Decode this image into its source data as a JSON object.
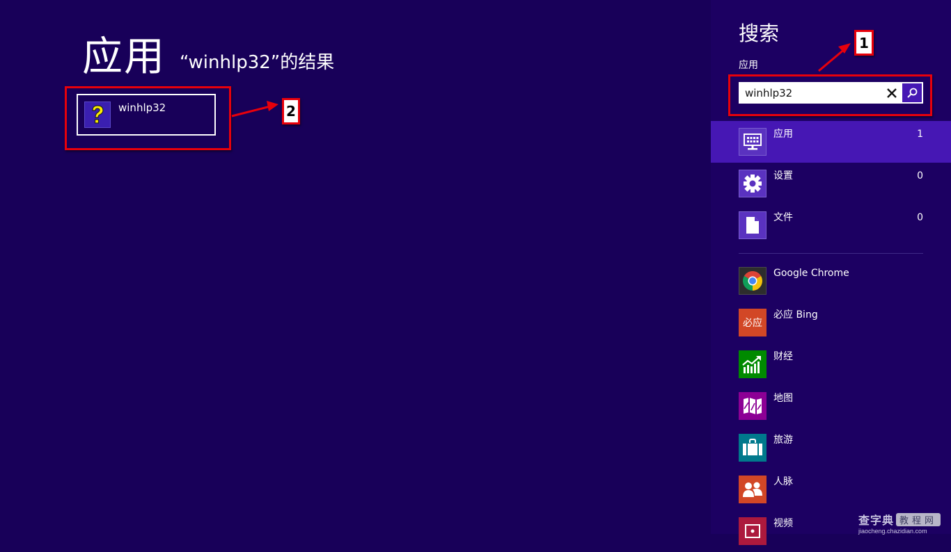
{
  "main": {
    "title": "应用",
    "subtitle": "“winhlp32”的结果",
    "results": [
      {
        "label": "winhlp32",
        "icon": "help-question-icon"
      }
    ]
  },
  "search_pane": {
    "title": "搜索",
    "scope": "应用",
    "query": "winhlp32",
    "clear_icon": "close-icon",
    "search_icon": "search-icon",
    "categories": [
      {
        "label": "应用",
        "count": "1",
        "icon": "apps-icon",
        "selected": true
      },
      {
        "label": "设置",
        "count": "0",
        "icon": "gear-icon",
        "selected": false
      },
      {
        "label": "文件",
        "count": "0",
        "icon": "file-icon",
        "selected": false
      }
    ],
    "apps": [
      {
        "label": "Google Chrome",
        "icon": "chrome-icon",
        "color": "#2d2d2d"
      },
      {
        "label": "必应 Bing",
        "icon": "bing-icon",
        "icon_text": "必应",
        "color": "#d24726"
      },
      {
        "label": "财经",
        "icon": "finance-chart-icon",
        "color": "#008a00"
      },
      {
        "label": "地图",
        "icon": "map-icon",
        "color": "#8c0095"
      },
      {
        "label": "旅游",
        "icon": "suitcase-icon",
        "color": "#00798c"
      },
      {
        "label": "人脉",
        "icon": "people-icon",
        "color": "#d24726"
      },
      {
        "label": "视频",
        "icon": "video-icon",
        "color": "#ac193d"
      }
    ]
  },
  "annotations": [
    {
      "label": "1",
      "target": "search-box"
    },
    {
      "label": "2",
      "target": "result-tile"
    }
  ],
  "watermark": {
    "brand": "查字典",
    "tag": "教程网",
    "url": "jiaocheng.chazidian.com"
  },
  "colors": {
    "background": "#180059",
    "pane": "#1c0062",
    "accent": "#4617b4",
    "annotation": "#e8000b"
  }
}
